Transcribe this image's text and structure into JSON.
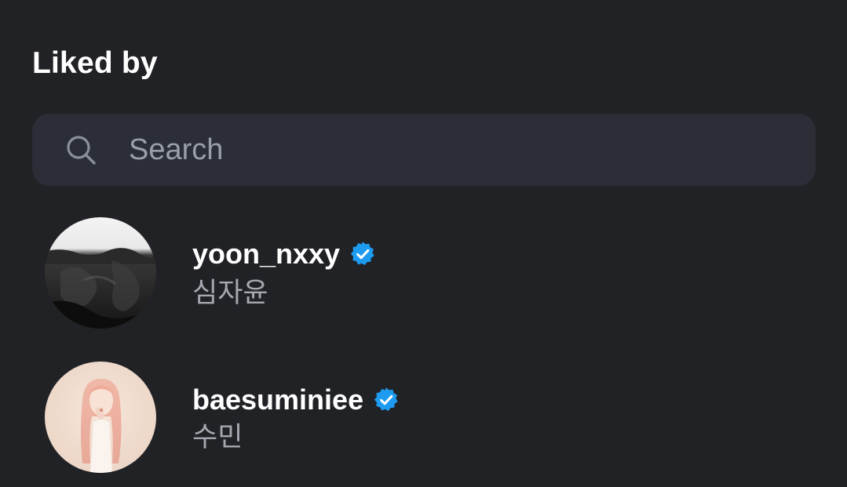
{
  "header": {
    "title": "Liked by"
  },
  "search": {
    "placeholder": "Search",
    "value": "",
    "icon": "search-icon"
  },
  "users": [
    {
      "username": "yoon_nxxy",
      "full_name": "심자윤",
      "verified": true,
      "avatar_icon": "profile-photo"
    },
    {
      "username": "baesuminiee",
      "full_name": "수민",
      "verified": true,
      "avatar_icon": "profile-photo"
    }
  ],
  "colors": {
    "background": "#212226",
    "search_background": "#2b2e36",
    "verified_badge": "#1d9bf0",
    "secondary_text": "#a5a8b0"
  }
}
